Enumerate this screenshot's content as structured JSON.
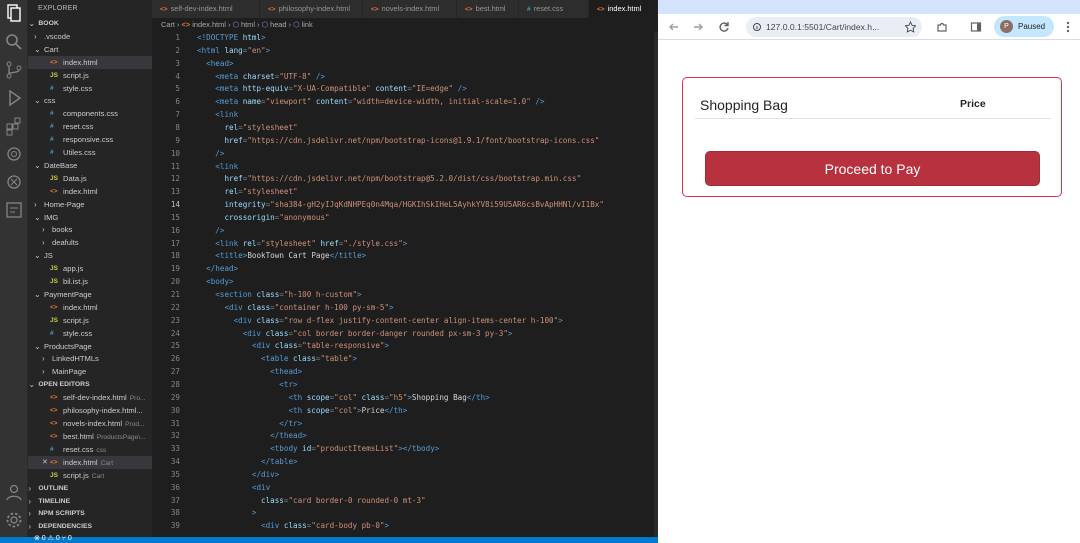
{
  "colors": {
    "accent": "#007acc",
    "danger": "#dc3545",
    "html_icon": "#e37933",
    "js_icon": "#cbcb41",
    "css_icon": "#519aba",
    "paused_pill": "#c2e7ff"
  },
  "activity_bar": {
    "icons": [
      "files-icon",
      "search-icon",
      "source-control-icon",
      "run-debug-icon",
      "extensions-icon",
      "remote-icon",
      "chatgpt-icon",
      "testing-icon",
      "account-icon",
      "settings-icon"
    ]
  },
  "explorer": {
    "title": "EXPLORER",
    "root": "BOOK",
    "tree": [
      {
        "label": ".vscode",
        "type": "folder",
        "open": false,
        "indent": 1
      },
      {
        "label": "Cart",
        "type": "folder",
        "open": true,
        "indent": 1
      },
      {
        "label": "index.html",
        "type": "html",
        "indent": 2,
        "selected": true
      },
      {
        "label": "script.js",
        "type": "js",
        "indent": 2
      },
      {
        "label": "style.css",
        "type": "css",
        "indent": 2
      },
      {
        "label": "css",
        "type": "folder",
        "open": true,
        "indent": 1
      },
      {
        "label": "components.css",
        "type": "css",
        "indent": 2
      },
      {
        "label": "reset.css",
        "type": "css",
        "indent": 2
      },
      {
        "label": "responsive.css",
        "type": "css",
        "indent": 2
      },
      {
        "label": "Utiles.css",
        "type": "css",
        "indent": 2
      },
      {
        "label": "DateBase",
        "type": "folder",
        "open": true,
        "indent": 1
      },
      {
        "label": "Data.js",
        "type": "js",
        "indent": 2
      },
      {
        "label": "index.html",
        "type": "html",
        "indent": 2
      },
      {
        "label": "Home-Page",
        "type": "folder",
        "open": false,
        "indent": 1
      },
      {
        "label": "IMG",
        "type": "folder",
        "open": true,
        "indent": 1
      },
      {
        "label": "books",
        "type": "folder",
        "open": false,
        "indent": 2
      },
      {
        "label": "deafults",
        "type": "folder",
        "open": false,
        "indent": 2
      },
      {
        "label": "JS",
        "type": "folder",
        "open": true,
        "indent": 1
      },
      {
        "label": "app.js",
        "type": "js",
        "indent": 2
      },
      {
        "label": "bil.ist.js",
        "type": "js",
        "indent": 2
      },
      {
        "label": "PaymentPage",
        "type": "folder",
        "open": true,
        "indent": 1
      },
      {
        "label": "index.html",
        "type": "html",
        "indent": 2
      },
      {
        "label": "script.js",
        "type": "js",
        "indent": 2
      },
      {
        "label": "style.css",
        "type": "css",
        "indent": 2
      },
      {
        "label": "ProductsPage",
        "type": "folder",
        "open": true,
        "indent": 1
      },
      {
        "label": "LinkedHTMLs",
        "type": "folder",
        "open": false,
        "indent": 2
      },
      {
        "label": "MainPage",
        "type": "folder",
        "open": false,
        "indent": 2
      }
    ],
    "open_editors_title": "OPEN EDITORS",
    "open_editors": [
      {
        "label": "self-dev-index.html",
        "sub": "Pro...",
        "type": "html"
      },
      {
        "label": "philosophy-index.html...",
        "sub": "",
        "type": "html"
      },
      {
        "label": "novels-index.html",
        "sub": "Prod...",
        "type": "html"
      },
      {
        "label": "best.html",
        "sub": "ProductsPage\\...",
        "type": "html"
      },
      {
        "label": "reset.css",
        "sub": "css",
        "type": "css"
      },
      {
        "label": "index.html",
        "sub": "Cart",
        "type": "html",
        "close": true,
        "selected": true
      },
      {
        "label": "script.js",
        "sub": "Cart",
        "type": "js"
      }
    ],
    "sections": [
      "OUTLINE",
      "TIMELINE",
      "NPM SCRIPTS",
      "DEPENDENCIES"
    ]
  },
  "editor": {
    "tabs": [
      {
        "label": "self-dev-index.html",
        "type": "html"
      },
      {
        "label": "philosophy-index.html",
        "type": "html"
      },
      {
        "label": "novels-index.html",
        "type": "html"
      },
      {
        "label": "best.html",
        "type": "html"
      },
      {
        "label": "reset.css",
        "type": "css"
      },
      {
        "label": "index.html",
        "type": "html",
        "active": true
      }
    ],
    "breadcrumb": [
      "Cart",
      "index.html",
      "html",
      "head",
      "link"
    ],
    "current_line": 14,
    "lines": [
      [
        [
          "tg",
          "<!DOCTYPE "
        ],
        [
          "at",
          "html"
        ],
        [
          "tg",
          ">"
        ]
      ],
      [
        [
          "tg",
          "<html "
        ],
        [
          "at",
          "lang"
        ],
        [
          "pn",
          "="
        ],
        [
          "st",
          "\"en\""
        ],
        [
          "tg",
          ">"
        ]
      ],
      [
        [
          "tx",
          "  "
        ],
        [
          "tg",
          "<head>"
        ]
      ],
      [
        [
          "tx",
          "    "
        ],
        [
          "tg",
          "<meta "
        ],
        [
          "at",
          "charset"
        ],
        [
          "pn",
          "="
        ],
        [
          "st",
          "\"UTF-8\""
        ],
        [
          "tg",
          " />"
        ]
      ],
      [
        [
          "tx",
          "    "
        ],
        [
          "tg",
          "<meta "
        ],
        [
          "at",
          "http-equiv"
        ],
        [
          "pn",
          "="
        ],
        [
          "st",
          "\"X-UA-Compatible\""
        ],
        [
          "at",
          " content"
        ],
        [
          "pn",
          "="
        ],
        [
          "st",
          "\"IE=edge\""
        ],
        [
          "tg",
          " />"
        ]
      ],
      [
        [
          "tx",
          "    "
        ],
        [
          "tg",
          "<meta "
        ],
        [
          "at",
          "name"
        ],
        [
          "pn",
          "="
        ],
        [
          "st",
          "\"viewport\""
        ],
        [
          "at",
          " content"
        ],
        [
          "pn",
          "="
        ],
        [
          "st",
          "\"width=device-width, initial-scale=1.0\""
        ],
        [
          "tg",
          " />"
        ]
      ],
      [
        [
          "tx",
          "    "
        ],
        [
          "tg",
          "<link"
        ]
      ],
      [
        [
          "tx",
          "      "
        ],
        [
          "at",
          "rel"
        ],
        [
          "pn",
          "="
        ],
        [
          "st",
          "\"stylesheet\""
        ]
      ],
      [
        [
          "tx",
          "      "
        ],
        [
          "at",
          "href"
        ],
        [
          "pn",
          "="
        ],
        [
          "st",
          "\"https://cdn.jsdelivr.net/npm/bootstrap-icons@1.9.1/font/bootstrap-icons.css\""
        ]
      ],
      [
        [
          "tx",
          "    "
        ],
        [
          "tg",
          "/>"
        ]
      ],
      [
        [
          "tx",
          "    "
        ],
        [
          "tg",
          "<link"
        ]
      ],
      [
        [
          "tx",
          "      "
        ],
        [
          "at",
          "href"
        ],
        [
          "pn",
          "="
        ],
        [
          "st",
          "\"https://cdn.jsdelivr.net/npm/bootstrap@5.2.0/dist/css/bootstrap.min.css\""
        ]
      ],
      [
        [
          "tx",
          "      "
        ],
        [
          "at",
          "rel"
        ],
        [
          "pn",
          "="
        ],
        [
          "st",
          "\"stylesheet\""
        ]
      ],
      [
        [
          "tx",
          "      "
        ],
        [
          "at",
          "integrity"
        ],
        [
          "pn",
          "="
        ],
        [
          "st",
          "\"sha384-gH2yIJqKdNHPEq0n4Mqa/HGKIhSkIHeL5AyhkYV8i59U5AR6csBvApHHNl/vI1Bx\""
        ]
      ],
      [
        [
          "tx",
          "      "
        ],
        [
          "at",
          "crossorigin"
        ],
        [
          "pn",
          "="
        ],
        [
          "st",
          "\"anonymous\""
        ]
      ],
      [
        [
          "tx",
          "    "
        ],
        [
          "tg",
          "/>"
        ]
      ],
      [
        [
          "tx",
          "    "
        ],
        [
          "tg",
          "<link "
        ],
        [
          "at",
          "rel"
        ],
        [
          "pn",
          "="
        ],
        [
          "st",
          "\"stylesheet\""
        ],
        [
          "at",
          " href"
        ],
        [
          "pn",
          "="
        ],
        [
          "st",
          "\"./style.css\""
        ],
        [
          "tg",
          ">"
        ]
      ],
      [
        [
          "tx",
          "    "
        ],
        [
          "tg",
          "<title>"
        ],
        [
          "tx",
          "BookTown Cart Page"
        ],
        [
          "tg",
          "</title>"
        ]
      ],
      [
        [
          "tx",
          "  "
        ],
        [
          "tg",
          "</head>"
        ]
      ],
      [
        [
          "tx",
          "  "
        ],
        [
          "tg",
          "<body>"
        ]
      ],
      [
        [
          "tx",
          "    "
        ],
        [
          "tg",
          "<section "
        ],
        [
          "at",
          "class"
        ],
        [
          "pn",
          "="
        ],
        [
          "st",
          "\"h-100 h-custom\""
        ],
        [
          "tg",
          ">"
        ]
      ],
      [
        [
          "tx",
          "      "
        ],
        [
          "tg",
          "<div "
        ],
        [
          "at",
          "class"
        ],
        [
          "pn",
          "="
        ],
        [
          "st",
          "\"container h-100 py-sm-5\""
        ],
        [
          "tg",
          ">"
        ]
      ],
      [
        [
          "tx",
          "        "
        ],
        [
          "tg",
          "<div "
        ],
        [
          "at",
          "class"
        ],
        [
          "pn",
          "="
        ],
        [
          "st",
          "\"row d-flex justify-content-center align-items-center h-100\""
        ],
        [
          "tg",
          ">"
        ]
      ],
      [
        [
          "tx",
          "          "
        ],
        [
          "tg",
          "<div "
        ],
        [
          "at",
          "class"
        ],
        [
          "pn",
          "="
        ],
        [
          "st",
          "\"col border border-danger rounded px-sm-3 py-3\""
        ],
        [
          "tg",
          ">"
        ]
      ],
      [
        [
          "tx",
          "            "
        ],
        [
          "tg",
          "<div "
        ],
        [
          "at",
          "class"
        ],
        [
          "pn",
          "="
        ],
        [
          "st",
          "\"table-responsive\""
        ],
        [
          "tg",
          ">"
        ]
      ],
      [
        [
          "tx",
          "              "
        ],
        [
          "tg",
          "<table "
        ],
        [
          "at",
          "class"
        ],
        [
          "pn",
          "="
        ],
        [
          "st",
          "\"table\""
        ],
        [
          "tg",
          ">"
        ]
      ],
      [
        [
          "tx",
          "                "
        ],
        [
          "tg",
          "<thead>"
        ]
      ],
      [
        [
          "tx",
          "                  "
        ],
        [
          "tg",
          "<tr>"
        ]
      ],
      [
        [
          "tx",
          "                    "
        ],
        [
          "tg",
          "<th "
        ],
        [
          "at",
          "scope"
        ],
        [
          "pn",
          "="
        ],
        [
          "st",
          "\"col\""
        ],
        [
          "at",
          " class"
        ],
        [
          "pn",
          "="
        ],
        [
          "st",
          "\"h5\""
        ],
        [
          "tg",
          ">"
        ],
        [
          "tx",
          "Shopping Bag"
        ],
        [
          "tg",
          "</th>"
        ]
      ],
      [
        [
          "tx",
          "                    "
        ],
        [
          "tg",
          "<th "
        ],
        [
          "at",
          "scope"
        ],
        [
          "pn",
          "="
        ],
        [
          "st",
          "\"col\""
        ],
        [
          "tg",
          ">"
        ],
        [
          "tx",
          "Price"
        ],
        [
          "tg",
          "</th>"
        ]
      ],
      [
        [
          "tx",
          "                  "
        ],
        [
          "tg",
          "</tr>"
        ]
      ],
      [
        [
          "tx",
          "                "
        ],
        [
          "tg",
          "</thead>"
        ]
      ],
      [
        [
          "tx",
          "                "
        ],
        [
          "tg",
          "<tbody "
        ],
        [
          "at",
          "id"
        ],
        [
          "pn",
          "="
        ],
        [
          "st",
          "\"productItemsList\""
        ],
        [
          "tg",
          "></tbody>"
        ]
      ],
      [
        [
          "tx",
          "              "
        ],
        [
          "tg",
          "</table>"
        ]
      ],
      [
        [
          "tx",
          "            "
        ],
        [
          "tg",
          "</div>"
        ]
      ],
      [
        [
          "tx",
          "            "
        ],
        [
          "tg",
          "<div"
        ]
      ],
      [
        [
          "tx",
          "              "
        ],
        [
          "at",
          "class"
        ],
        [
          "pn",
          "="
        ],
        [
          "st",
          "\"card border-0 rounded-0 mt-3\""
        ]
      ],
      [
        [
          "tx",
          "            "
        ],
        [
          "tg",
          ">"
        ]
      ],
      [
        [
          "tx",
          "              "
        ],
        [
          "tg",
          "<div "
        ],
        [
          "at",
          "class"
        ],
        [
          "pn",
          "="
        ],
        [
          "st",
          "\"card-body pb-0\""
        ],
        [
          "tg",
          ">"
        ]
      ]
    ]
  },
  "status_bar": {
    "text": "⊗ 0 ⚠ 0   ⑂ 0"
  },
  "browser": {
    "url": "127.0.0.1:5501/Cart/index.h...",
    "paused_label": "Paused",
    "profile_initial": "P",
    "page": {
      "th_shopping_bag": "Shopping Bag",
      "th_price": "Price",
      "pay_button": "Proceed to Pay"
    }
  }
}
